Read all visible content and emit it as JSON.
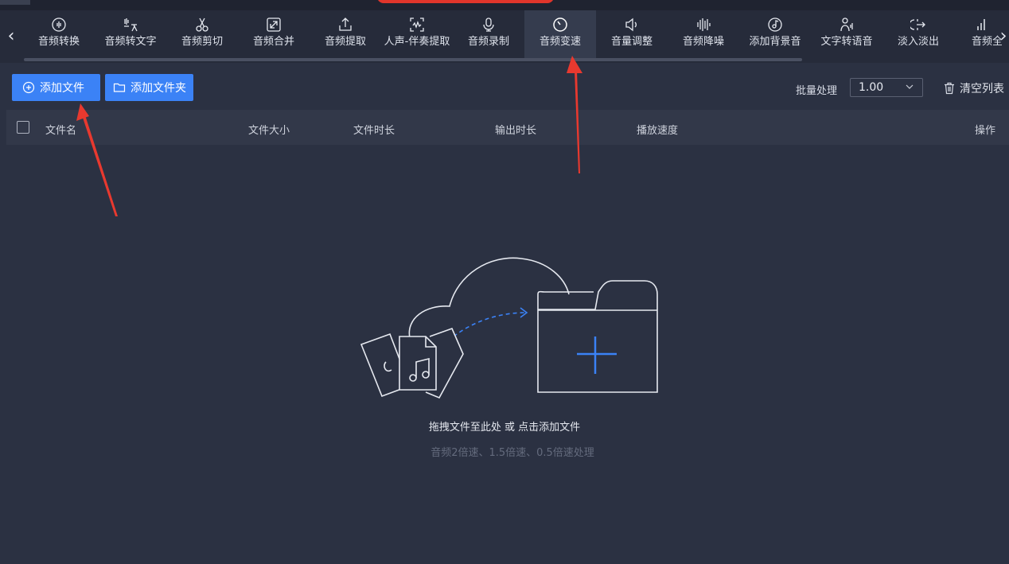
{
  "toolbar_nav": {
    "tools": [
      {
        "label": "音频转换",
        "icon": "audio-convert-icon"
      },
      {
        "label": "音频转文字",
        "icon": "speech-to-text-icon"
      },
      {
        "label": "音频剪切",
        "icon": "scissors-icon"
      },
      {
        "label": "音频合并",
        "icon": "merge-icon"
      },
      {
        "label": "音频提取",
        "icon": "extract-icon"
      },
      {
        "label": "人声-伴奏提取",
        "icon": "vocal-extract-icon"
      },
      {
        "label": "音频录制",
        "icon": "microphone-icon"
      },
      {
        "label": "音频变速",
        "icon": "speedometer-icon",
        "active": true
      },
      {
        "label": "音量调整",
        "icon": "volume-icon"
      },
      {
        "label": "音频降噪",
        "icon": "noise-reduction-icon"
      },
      {
        "label": "添加背景音",
        "icon": "background-music-icon"
      },
      {
        "label": "文字转语音",
        "icon": "text-to-speech-icon"
      },
      {
        "label": "淡入淡出",
        "icon": "fade-icon"
      },
      {
        "label": "音频全",
        "icon": "audio-bars-icon"
      }
    ]
  },
  "actions": {
    "add_file": "添加文件",
    "add_folder": "添加文件夹",
    "batch_label": "批量处理",
    "batch_value": "1.00",
    "clear_list": "清空列表"
  },
  "table": {
    "columns": {
      "name": "文件名",
      "size": "文件大小",
      "duration": "文件时长",
      "output_duration": "输出时长",
      "speed": "播放速度",
      "ops": "操作"
    }
  },
  "empty_state": {
    "main": "拖拽文件至此处 或 点击添加文件",
    "sub": "音频2倍速、1.5倍速、0.5倍速处理"
  },
  "colors": {
    "background": "#2b3142",
    "nav_background": "#262b3a",
    "accent_blue": "#3b82f6",
    "annotation_red": "#e8392f"
  }
}
